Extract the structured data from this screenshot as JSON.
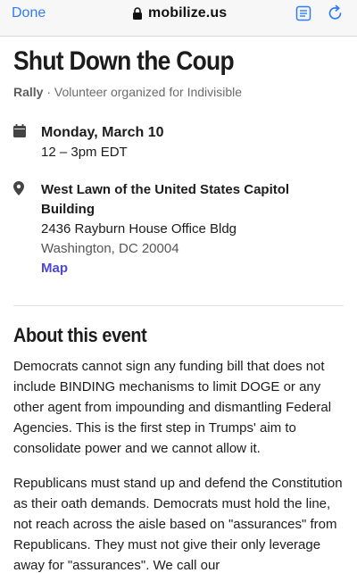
{
  "browser": {
    "done_label": "Done",
    "url": "mobilize.us",
    "icons": {
      "lock": "lock-icon",
      "reader": "reader-view-icon",
      "reload": "reload-icon"
    },
    "accent_color": "#2f7cf6"
  },
  "event": {
    "title": "Shut Down the Coup",
    "type": "Rally",
    "separator": " · ",
    "organizer": "Volunteer organized for Indivisible",
    "date": "Monday, March 10",
    "time": "12 – 3pm EDT",
    "location_name": "West Lawn of the United States Capitol Building",
    "address": "2436 Rayburn House Office Bldg",
    "city": "Washington, DC 20004",
    "map_label": "Map",
    "link_color": "#4b47d9"
  },
  "about": {
    "heading": "About this event",
    "paragraphs": [
      "Democrats cannot sign any funding bill that does not include BINDING mechanisms to limit DOGE or any other agent from impounding and dismantling Federal Agencies. This is the first step in Trumps' aim to consolidate power and we cannot allow it.",
      "Republicans must stand up and defend the Constitution as their oath demands. Democrats must hold the line, not reach across the aisle based on \"assurances\" from Republicans. They must not give their only leverage away for \"assurances\". We call our"
    ]
  }
}
